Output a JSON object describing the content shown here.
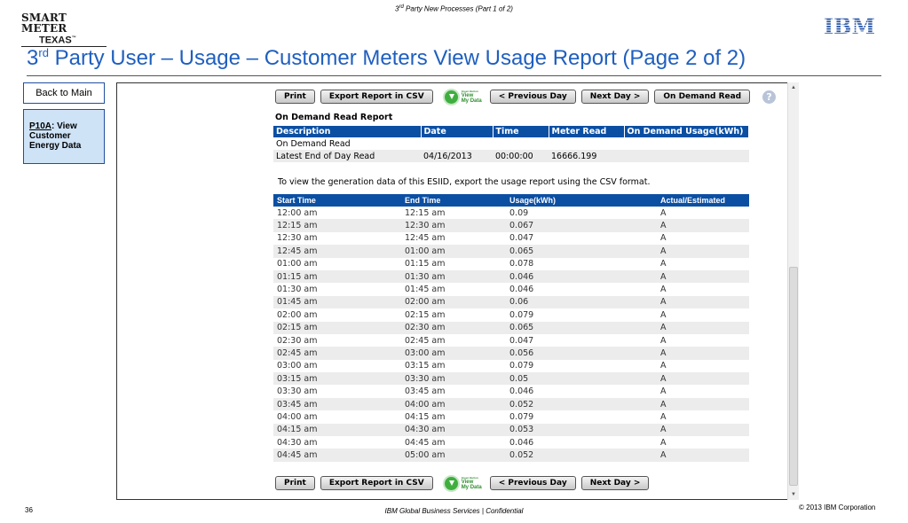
{
  "header": {
    "note_pre": "3",
    "note_sup": "rd",
    "note_post": " Party New Processes (Part 1 of 2)",
    "logo_line1": "SMART METER",
    "logo_line2": "TEXAS",
    "logo_tm": "™",
    "ibm_logo": "IBM"
  },
  "title": {
    "pre": "3",
    "sup": "rd",
    "post": " Party User – Usage – Customer Meters View Usage Report (Page 2 of 2)"
  },
  "sidebar": {
    "back_label": "Back to Main",
    "link_text": "P10A",
    "box_text": ": View Customer Energy Data"
  },
  "toolbar": {
    "print": "Print",
    "export": "Export Report in CSV",
    "green_button_small": "Green Button",
    "green_button_line1": "View",
    "green_button_line2": "My Data",
    "prev_day": "< Previous Day",
    "next_day": "Next Day >",
    "on_demand": "On Demand Read",
    "help_icon": "?"
  },
  "on_demand": {
    "title": "On Demand Read Report",
    "columns": [
      "Description",
      "Date",
      "Time",
      "Meter Read",
      "On Demand Usage(kWh)"
    ],
    "rows": [
      [
        "On Demand Read",
        "",
        "",
        "",
        ""
      ],
      [
        "Latest End of Day Read",
        "04/16/2013",
        "00:00:00",
        "16666.199",
        ""
      ]
    ]
  },
  "csv_note": "To view the generation data of this ESIID, export the usage report using the CSV format.",
  "usage": {
    "columns": [
      "Start Time",
      "End Time",
      "Usage(kWh)",
      "Actual/Estimated"
    ],
    "rows": [
      [
        "12:00 am",
        "12:15 am",
        "0.09",
        "A"
      ],
      [
        "12:15 am",
        "12:30 am",
        "0.067",
        "A"
      ],
      [
        "12:30 am",
        "12:45 am",
        "0.047",
        "A"
      ],
      [
        "12:45 am",
        "01:00 am",
        "0.065",
        "A"
      ],
      [
        "01:00 am",
        "01:15 am",
        "0.078",
        "A"
      ],
      [
        "01:15 am",
        "01:30 am",
        "0.046",
        "A"
      ],
      [
        "01:30 am",
        "01:45 am",
        "0.046",
        "A"
      ],
      [
        "01:45 am",
        "02:00 am",
        "0.06",
        "A"
      ],
      [
        "02:00 am",
        "02:15 am",
        "0.079",
        "A"
      ],
      [
        "02:15 am",
        "02:30 am",
        "0.065",
        "A"
      ],
      [
        "02:30 am",
        "02:45 am",
        "0.047",
        "A"
      ],
      [
        "02:45 am",
        "03:00 am",
        "0.056",
        "A"
      ],
      [
        "03:00 am",
        "03:15 am",
        "0.079",
        "A"
      ],
      [
        "03:15 am",
        "03:30 am",
        "0.05",
        "A"
      ],
      [
        "03:30 am",
        "03:45 am",
        "0.046",
        "A"
      ],
      [
        "03:45 am",
        "04:00 am",
        "0.052",
        "A"
      ],
      [
        "04:00 am",
        "04:15 am",
        "0.079",
        "A"
      ],
      [
        "04:15 am",
        "04:30 am",
        "0.053",
        "A"
      ],
      [
        "04:30 am",
        "04:45 am",
        "0.046",
        "A"
      ],
      [
        "04:45 am",
        "05:00 am",
        "0.052",
        "A"
      ]
    ]
  },
  "footer": {
    "page_number": "36",
    "center": "IBM Global Business Services |  Confidential",
    "copyright": "© 2013 IBM Corporation"
  }
}
